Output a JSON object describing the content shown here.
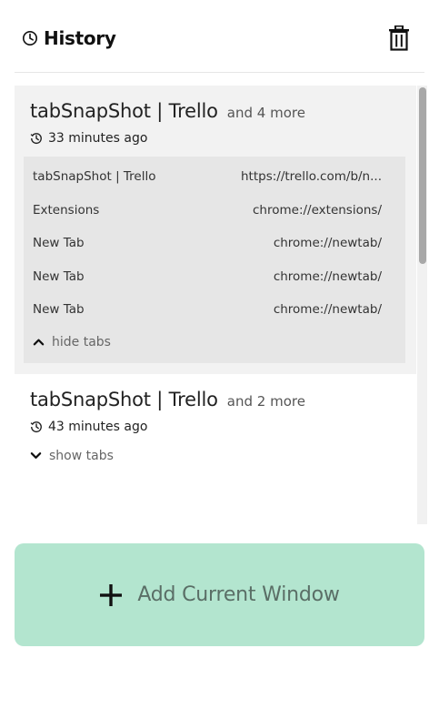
{
  "header": {
    "title": "History",
    "title_icon": "clock-icon",
    "delete_icon": "trash-icon"
  },
  "snapshots": [
    {
      "title": "tabSnapShot | Trello",
      "more": "and 4 more",
      "time": "33 minutes ago",
      "expanded": true,
      "tabs": [
        {
          "name": "tabSnapShot | Trello",
          "url": "https://trello.com/b/n..."
        },
        {
          "name": "Extensions",
          "url": "chrome://extensions/"
        },
        {
          "name": "New Tab",
          "url": "chrome://newtab/"
        },
        {
          "name": "New Tab",
          "url": "chrome://newtab/"
        },
        {
          "name": "New Tab",
          "url": "chrome://newtab/"
        }
      ],
      "toggle_label": "hide tabs"
    },
    {
      "title": "tabSnapShot | Trello",
      "more": "and 2 more",
      "time": "43 minutes ago",
      "expanded": false,
      "toggle_label": "show tabs"
    }
  ],
  "add_button": {
    "label": "Add Current Window",
    "icon": "plus-icon"
  },
  "colors": {
    "add_button_bg": "#b3e5cf",
    "expanded_bg": "#f2f2f2",
    "tabs_bg": "#e6e6e6"
  }
}
